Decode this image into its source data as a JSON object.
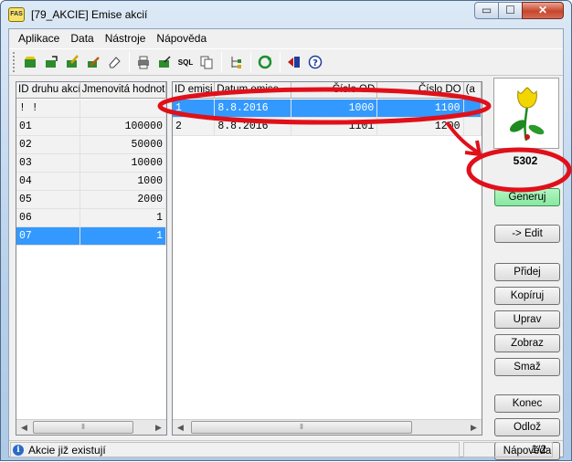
{
  "window": {
    "title": "[79_AKCIE] Emise akcií",
    "app_icon_text": "FAS",
    "buttons": {
      "minimize": "▭",
      "maximize": "☐",
      "close": "✕"
    }
  },
  "menu": [
    "Aplikace",
    "Data",
    "Nástroje",
    "Nápověda"
  ],
  "toolbar": {
    "icons": [
      "new-icon",
      "open-icon",
      "edit-icon",
      "tools-icon",
      "eraser-icon",
      "print-icon",
      "export-icon",
      "sql-icon",
      "copy-icon",
      "tree-icon",
      "refresh-icon",
      "exit-icon",
      "help-icon"
    ],
    "sql_label": "SQL"
  },
  "left_grid": {
    "columns": [
      "ID druhu akcí",
      "Jmenovitá hodnota"
    ],
    "rows": [
      [
        "! !",
        ""
      ],
      [
        "01",
        "100000"
      ],
      [
        "02",
        "50000"
      ],
      [
        "03",
        "10000"
      ],
      [
        "04",
        "1000"
      ],
      [
        "05",
        "2000"
      ],
      [
        "06",
        "1"
      ],
      [
        "07",
        "1"
      ]
    ],
    "selected_row": 7
  },
  "right_grid": {
    "columns": [
      "ID emisi",
      "Datum emise",
      "Číslo OD",
      "Číslo DO",
      "(a"
    ],
    "rows": [
      [
        "1",
        "8.8.2016",
        "1000",
        "1100"
      ],
      [
        "2",
        "8.8.2016",
        "1101",
        "1200"
      ]
    ],
    "selected_row": 0
  },
  "side": {
    "code": "5302",
    "buttons": {
      "generate": "Generuj",
      "edit": "-> Edit",
      "add": "Přidej",
      "copy": "Kopíruj",
      "modify": "Uprav",
      "show": "Zobraz",
      "delete": "Smaž",
      "end": "Konec",
      "logout": "Odlož",
      "help": "Nápověda"
    }
  },
  "status": {
    "message": "Akcie již existují",
    "page": "1/2"
  },
  "colors": {
    "selection": "#3399ff",
    "annotation": "#e0101a",
    "generate_button": "#8aeaa2"
  }
}
